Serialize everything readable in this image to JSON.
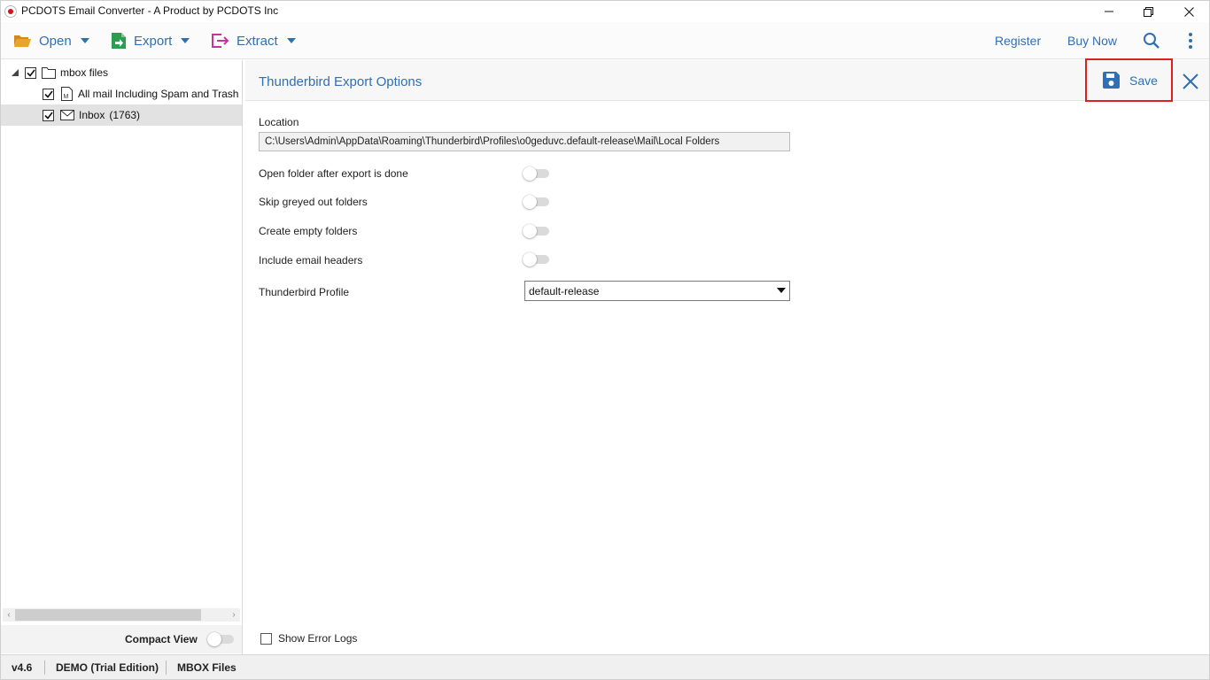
{
  "window": {
    "title": "PCDOTS Email Converter - A Product by PCDOTS Inc"
  },
  "toolbar": {
    "open_label": "Open",
    "export_label": "Export",
    "extract_label": "Extract",
    "register_label": "Register",
    "buy_now_label": "Buy Now",
    "icons": [
      "folder-open-icon",
      "export-icon",
      "extract-icon",
      "search-icon",
      "more-vertical-icon"
    ]
  },
  "tree": {
    "root": {
      "label": "mbox files",
      "checked": true,
      "expanded": true
    },
    "children": [
      {
        "label": "All mail Including Spam and Trash",
        "checked": true,
        "icon": "mbox-file-icon"
      },
      {
        "label": "Inbox",
        "count": "(1763)",
        "checked": true,
        "icon": "envelope-icon",
        "selected": true
      }
    ]
  },
  "left_footer": {
    "compact_view_label": "Compact View",
    "compact_view_on": false
  },
  "options": {
    "title": "Thunderbird Export Options",
    "save_label": "Save",
    "location_label": "Location",
    "location_value": "C:\\Users\\Admin\\AppData\\Roaming\\Thunderbird\\Profiles\\o0geduvc.default-release\\Mail\\Local Folders",
    "toggles": [
      {
        "label": "Open folder after export is done",
        "on": false
      },
      {
        "label": "Skip greyed out folders",
        "on": false
      },
      {
        "label": "Create empty folders",
        "on": false
      },
      {
        "label": "Include email headers",
        "on": false
      }
    ],
    "profile_label": "Thunderbird Profile",
    "profile_value": "default-release",
    "show_error_logs_label": "Show Error Logs",
    "show_error_logs_checked": false
  },
  "status": {
    "version": "v4.6",
    "edition": "DEMO (Trial Edition)",
    "file_type": "MBOX Files"
  },
  "colors": {
    "accent": "#2f6fb3",
    "highlight_border": "#e0201f",
    "export_green": "#2e9b4f",
    "extract_magenta": "#c4369c",
    "folder_yellow": "#e9a42a"
  }
}
